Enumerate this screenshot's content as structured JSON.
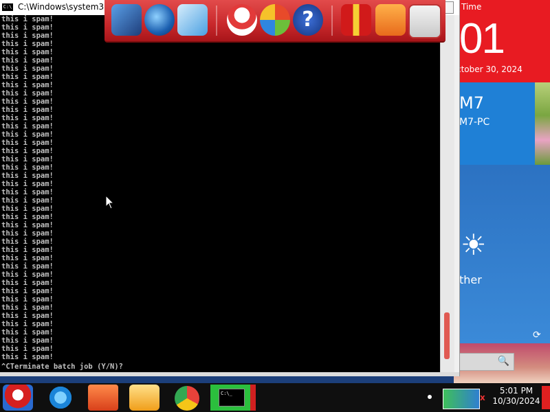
{
  "window": {
    "title": "C:\\Windows\\system32\\",
    "icon_text": "C:\\"
  },
  "console": {
    "repeat_line": "this i spam!",
    "line_count": 42,
    "prompt": "^CTerminate batch job (Y/N)?"
  },
  "dock": {
    "items": [
      {
        "icon": "computer-icon"
      },
      {
        "icon": "globe-icon"
      },
      {
        "icon": "control-panel-icon"
      },
      {
        "icon": "snowman-icon"
      },
      {
        "icon": "windows-icon"
      },
      {
        "icon": "help-icon",
        "glyph": "?"
      },
      {
        "icon": "gift-icon"
      },
      {
        "icon": "folder-icon"
      },
      {
        "icon": "recycle-bin-icon"
      }
    ]
  },
  "gadgets": {
    "time_label": "Time",
    "time_big": "01",
    "date_line": "ctober 30, 2024",
    "user_name": "M7",
    "pc_name": "M7-PC",
    "weather_text": "ther",
    "refresh_glyph": "⟳",
    "search_glyph": "🔍"
  },
  "taskbar": {
    "cmd_text": "C:\\_",
    "clock_time": "5:01 PM",
    "clock_date": "10/30/2024",
    "tray_x": "x"
  },
  "colors": {
    "console_bg": "#000000",
    "console_text": "#c0c0c0",
    "dock_red": "#c8282b",
    "time_tile": "#e81b22",
    "taskbar_bg": "#0f0f0f",
    "cmd_taskbar_green": "#2bbf3d"
  }
}
